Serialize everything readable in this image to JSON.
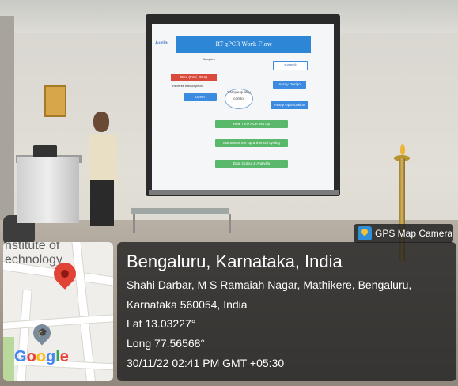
{
  "slide": {
    "title": "RT-qPCR Work Flow",
    "logo": "Aurin",
    "samples_label": "Samples",
    "rna_box": "RNA (total, RNA)",
    "reverse_transcription": "Reverse transcription",
    "cdna_box": "cDNA",
    "quality_control": "Sample quality control",
    "sybr_box": "SYBR®",
    "assay_design": "Assay Design",
    "assay_optimization": "Assay Optimization",
    "realtime_setup": "Real Time PCR Set Up",
    "instrument_setup": "Instrument Set Up & thermal cycling",
    "data_output": "Data Output & Analysis"
  },
  "camera_badge": {
    "label": "GPS Map Camera",
    "icon": "gps-map-camera-icon",
    "icon_color": "#2f8fd8"
  },
  "location": {
    "title": "Bengaluru, Karnataka, India",
    "address_line1": "Shahi Darbar, M S Ramaiah Nagar, Mathikere, Bengaluru,",
    "address_line2": "Karnataka 560054, India",
    "latitude": "Lat 13.03227°",
    "longitude": "Long 77.56568°",
    "timestamp": "30/11/22 02:41 PM GMT +05:30"
  },
  "map": {
    "label_top": "nstitute of",
    "label_mid": "echnology",
    "logo": {
      "g1": "G",
      "o1": "o",
      "o2": "o",
      "g2": "g",
      "l": "l",
      "e": "e"
    },
    "pin_color": "#e14436",
    "pin_icon": "map-pin-icon",
    "education_icon": "graduation-cap-icon"
  }
}
